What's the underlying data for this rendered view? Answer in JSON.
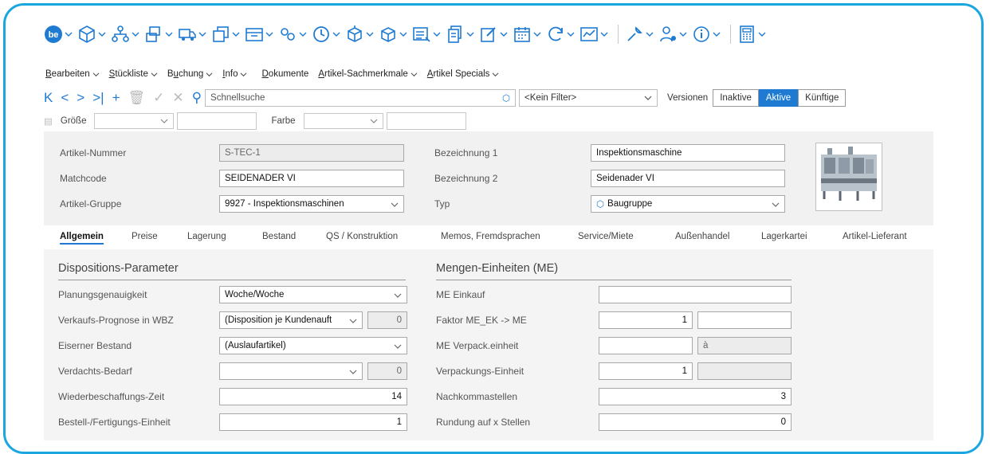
{
  "menu": {
    "items": [
      {
        "pre": "",
        "ul": "B",
        "post": "earbeiten",
        "chev": true
      },
      {
        "pre": "",
        "ul": "S",
        "post": "tückliste",
        "chev": true
      },
      {
        "pre": "B",
        "ul": "u",
        "post": "chung",
        "chev": true
      },
      {
        "pre": "",
        "ul": "I",
        "post": "nfo",
        "chev": true
      },
      {
        "pre": "",
        "ul": "D",
        "post": "okumente",
        "chev": false
      },
      {
        "pre": "",
        "ul": "A",
        "post": "rtikel-Sachmerkmale",
        "chev": true
      },
      {
        "pre": "",
        "ul": "A",
        "post": "rtikel Specials",
        "chev": true
      }
    ]
  },
  "toolbar": {
    "icons": [
      "be-logo-icon",
      "cube-icon",
      "structure-icon",
      "stack-icon",
      "truck-icon",
      "copy-icon",
      "calendar-strip-icon",
      "settings-group-icon",
      "clock-icon",
      "box-icon",
      "box-out-icon",
      "list-icon",
      "pages-icon",
      "edit-icon",
      "calendar-icon",
      "refresh-icon",
      "chart-icon",
      "wrench-icon",
      "user-gear-icon",
      "info-icon",
      "calculator-icon"
    ]
  },
  "nav": {
    "search_placeholder": "Schnellsuche",
    "filter_value": "<Kein Filter>",
    "versions_label": "Versionen",
    "version_buttons": [
      "Inaktive",
      "Aktive",
      "Künftige"
    ],
    "active_version": "Aktive"
  },
  "variant": {
    "size_label": "Größe",
    "color_label": "Farbe"
  },
  "header": {
    "article_number_label": "Artikel-Nummer",
    "article_number_value": "S-TEC-1",
    "matchcode_label": "Matchcode",
    "matchcode_value": "SEIDENADER VI",
    "group_label": "Artikel-Gruppe",
    "group_value": "9927 - Inspektionsmaschinen",
    "desc1_label": "Bezeichnung 1",
    "desc1_value": "Inspektionsmaschine",
    "desc2_label": "Bezeichnung 2",
    "desc2_value": "Seidenader VI",
    "type_label": "Typ",
    "type_value": "Baugruppe"
  },
  "tabs": [
    "Allgemein",
    "Preise",
    "Lagerung",
    "Bestand",
    "QS / Konstruktion",
    "Memos, Fremdsprachen",
    "Service/Miete",
    "Außenhandel",
    "Lagerkartei",
    "Artikel-Lieferant"
  ],
  "dispo": {
    "title": "Dispositions-Parameter",
    "planning_label": "Planungsgenauigkeit",
    "planning_value": "Woche/Woche",
    "forecast_label": "Verkaufs-Prognose in WBZ",
    "forecast_value": "(Disposition je Kundenauft",
    "forecast_num": "0",
    "iron_label": "Eiserner Bestand",
    "iron_value": "(Auslaufartikel)",
    "suspect_label": "Verdachts-Bedarf",
    "suspect_value": "",
    "suspect_num": "0",
    "replenish_label": "Wiederbeschaffungs-Zeit",
    "replenish_value": "14",
    "order_label": "Bestell-/Fertigungs-Einheit",
    "order_value": "1"
  },
  "units": {
    "title": "Mengen-Einheiten (ME)",
    "purchase_label": "ME Einkauf",
    "purchase_value": "",
    "factor_label": "Faktor ME_EK -> ME",
    "factor_value": "1",
    "factor_extra": "",
    "pack_label": "ME Verpack.einheit",
    "pack_value": "",
    "pack_extra": "à",
    "packunit_label": "Verpackungs-Einheit",
    "packunit_value": "1",
    "packunit_extra": "",
    "decimals_label": "Nachkommastellen",
    "decimals_value": "3",
    "rounding_label": "Rundung auf x Stellen",
    "rounding_value": "0"
  },
  "colors": {
    "frame": "#1ba6e0",
    "accent": "#1f7bd1"
  }
}
